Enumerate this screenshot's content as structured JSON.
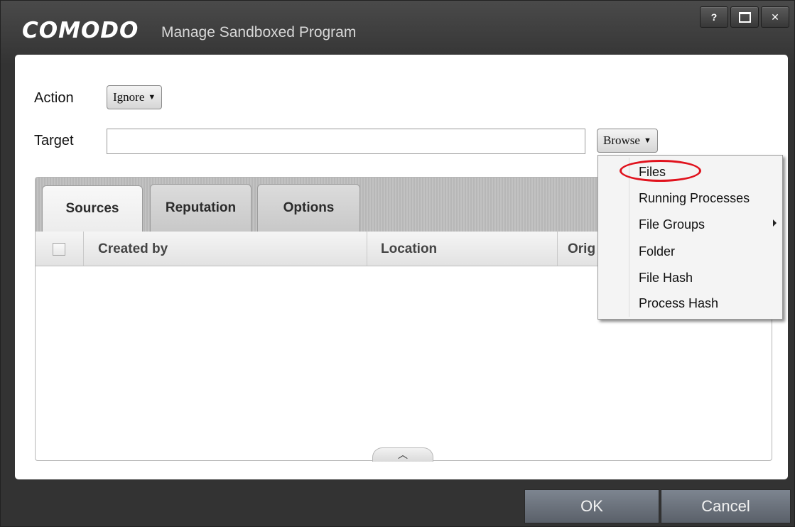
{
  "titlebar": {
    "brand": "COMODO",
    "title": "Manage Sandboxed Program",
    "controls": {
      "help": "?",
      "close": "✕"
    }
  },
  "form": {
    "action_label": "Action",
    "action_value": "Ignore",
    "target_label": "Target",
    "target_value": "",
    "browse_label": "Browse"
  },
  "tabs": [
    "Sources",
    "Reputation",
    "Options"
  ],
  "table": {
    "columns": [
      "Created by",
      "Location",
      "Orig"
    ]
  },
  "browse_menu": {
    "items": [
      "Files",
      "Running Processes",
      "File Groups",
      "Folder",
      "File Hash",
      "Process Hash"
    ],
    "highlighted_item": "Files",
    "highlight_color": "#e0121d"
  },
  "footer": {
    "ok_label": "OK",
    "cancel_label": "Cancel"
  },
  "colors": {
    "window_bg": "#333333",
    "panel_bg": "#ffffff",
    "footer_button": "#6a717b"
  }
}
